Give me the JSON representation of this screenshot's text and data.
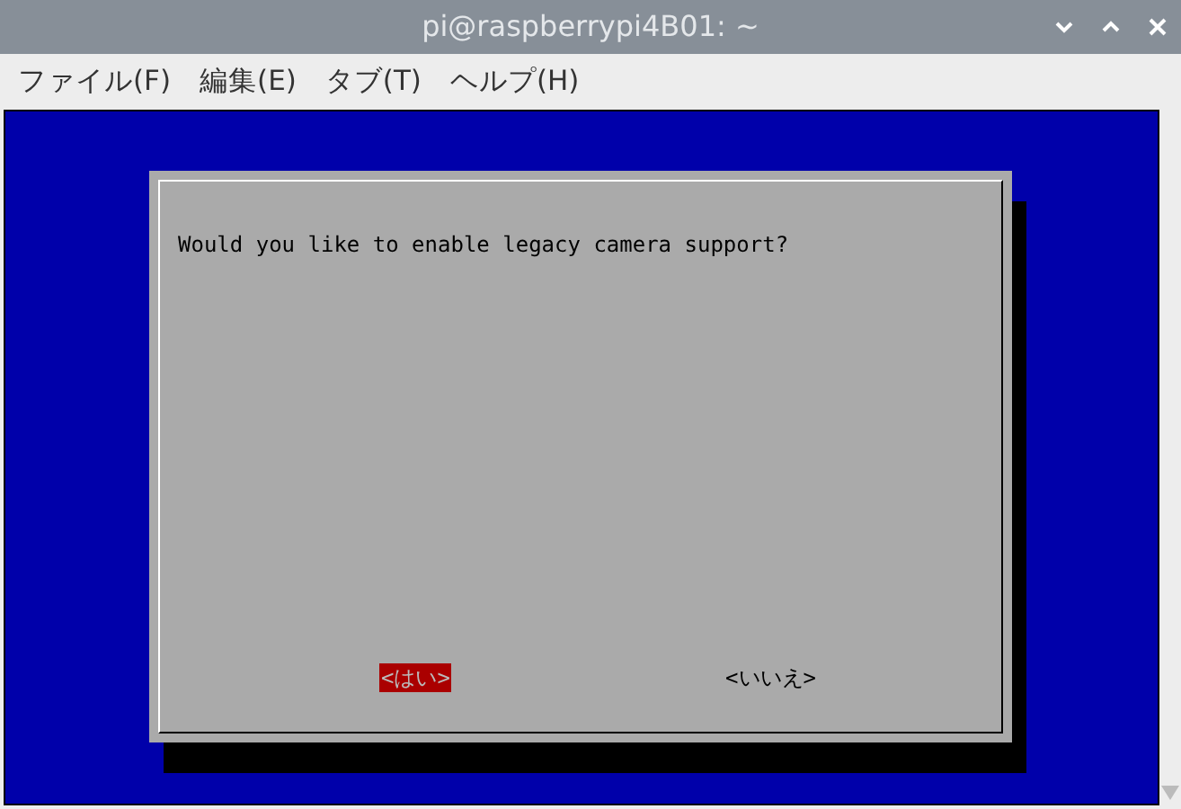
{
  "window": {
    "title": "pi@raspberrypi4B01: ~"
  },
  "menu": [
    {
      "label": "ファイル(F)"
    },
    {
      "label": "編集(E)"
    },
    {
      "label": "タブ(T)"
    },
    {
      "label": "ヘルプ(H)"
    }
  ],
  "dialog": {
    "message": "Would you like to enable legacy camera support?",
    "buttons": [
      {
        "label": "<はい>",
        "selected": true
      },
      {
        "label": "<いいえ>",
        "selected": false
      }
    ]
  }
}
